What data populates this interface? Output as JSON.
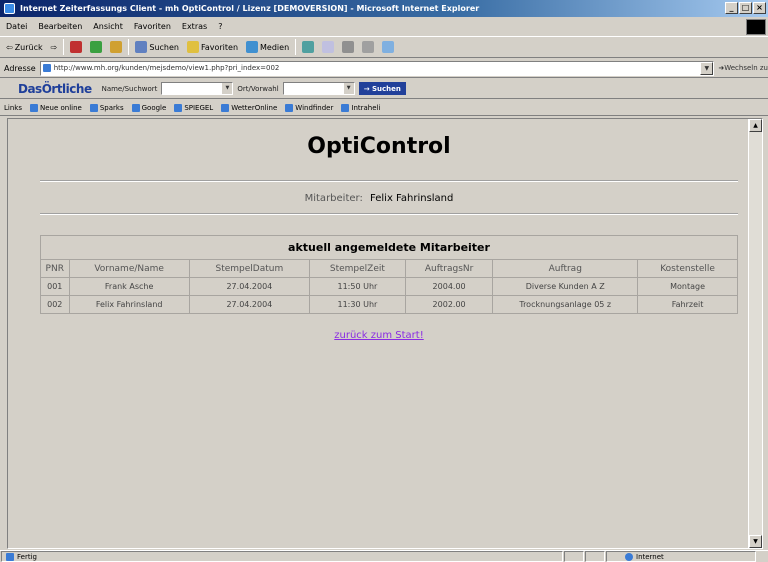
{
  "window": {
    "title": "Internet Zeiterfassungs Client - mh OptiControl / Lizenz [DEMOVERSION] - Microsoft Internet Explorer",
    "controls": [
      "_",
      "□",
      "×"
    ]
  },
  "menu": [
    "Datei",
    "Bearbeiten",
    "Ansicht",
    "Favoriten",
    "Extras",
    "?"
  ],
  "toolbar": {
    "back": "Zurück",
    "search": "Suchen",
    "favorites": "Favoriten",
    "media": "Medien"
  },
  "address": {
    "label": "Adresse",
    "url": "http://www.mh.org/kunden/mejsdemo/view1.php?pri_index=002",
    "go": "Wechseln zu"
  },
  "searchbar": {
    "brand": "DasÖrtliche",
    "name_placeholder": "Name/Suchwort",
    "city_label": "Ort/Vorwahl",
    "button": "Suchen"
  },
  "links": {
    "label": "Links",
    "items": [
      "Neue online",
      "Sparks",
      "Google",
      "SPIEGEL",
      "WetterOnline",
      "Windfinder",
      "Intraheli"
    ]
  },
  "page": {
    "title": "OptiControl",
    "employee_label": "Mitarbeiter:",
    "employee_name": "Felix Fahrinsland",
    "table_caption": "aktuell angemeldete Mitarbeiter",
    "back_link": "zurück zum Start!"
  },
  "table": {
    "columns": [
      "PNR",
      "Vorname/Name",
      "StempelDatum",
      "StempelZeit",
      "AuftragsNr",
      "Auftrag",
      "Kostenstelle"
    ],
    "rows": [
      [
        "001",
        "Frank Asche",
        "27.04.2004",
        "11:50 Uhr",
        "2004.00",
        "Diverse Kunden A Z",
        "Montage"
      ],
      [
        "002",
        "Felix Fahrinsland",
        "27.04.2004",
        "11:30 Uhr",
        "2002.00",
        "Trocknungsanlage 05 z",
        "Fahrzeit"
      ]
    ]
  },
  "status": {
    "text": "Fertig",
    "zone": "Internet"
  }
}
